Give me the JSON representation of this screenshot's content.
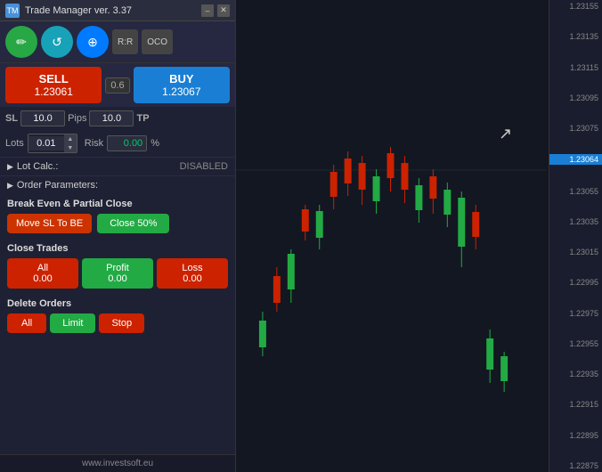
{
  "titleBar": {
    "appIcon": "TM",
    "title": "Trade Manager ver. 3.37",
    "minimizeLabel": "–",
    "closeLabel": "✕"
  },
  "toolbar": {
    "btn1Icon": "✏",
    "btn2Icon": "↺",
    "btn3Icon": "⊕",
    "btn4Label": "R:R",
    "btn5Label": "OCO"
  },
  "buySell": {
    "spread": "0.6",
    "sellLabel": "SELL",
    "sellPrice": "1.23061",
    "buyLabel": "BUY",
    "buyPrice": "1.23067"
  },
  "sltp": {
    "slLabel": "SL",
    "slValue": "10.0",
    "pipsLabel": "Pips",
    "tpValue": "10.0",
    "tpLabel": "TP"
  },
  "lots": {
    "lotsLabel": "Lots",
    "lotsValue": "0.01",
    "riskLabel": "Risk",
    "riskValue": "0.00",
    "percentLabel": "%"
  },
  "lotCalc": {
    "arrow": "▶",
    "label": "Lot Calc.:",
    "value": "DISABLED"
  },
  "orderParams": {
    "arrow": "▶",
    "label": "Order Parameters:"
  },
  "breakEven": {
    "title": "Break Even & Partial Close",
    "moveSLBtn": "Move SL To BE",
    "close50Btn": "Close 50%"
  },
  "closeTrades": {
    "title": "Close Trades",
    "allLabel": "All",
    "allValue": "0.00",
    "profitLabel": "Profit",
    "profitValue": "0.00",
    "lossLabel": "Loss",
    "lossValue": "0.00"
  },
  "deleteOrders": {
    "title": "Delete Orders",
    "allBtn": "All",
    "limitBtn": "Limit",
    "stopBtn": "Stop"
  },
  "footer": {
    "url": "www.investsoft.eu"
  },
  "priceAxis": {
    "prices": [
      "1.23155",
      "1.23135",
      "1.23115",
      "1.23095",
      "1.23075",
      "1.23064",
      "1.23055",
      "1.23035",
      "1.23015",
      "1.22995",
      "1.22975",
      "1.22955",
      "1.22935",
      "1.22915",
      "1.22895",
      "1.22875"
    ],
    "highlightPrice": "1.23064",
    "highlightIndex": 5
  }
}
